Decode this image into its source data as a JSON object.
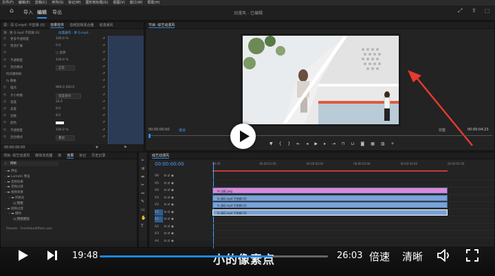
{
  "menubar": {
    "items": [
      "文件(F)",
      "编辑(E)",
      "剪辑(C)",
      "序列(S)",
      "标记(M)",
      "图形和标题(G)",
      "视图(V)",
      "窗口(W)",
      "帮助(H)"
    ]
  },
  "header": {
    "workspaces": [
      "导入",
      "编辑",
      "导出"
    ],
    "title": "动漫风 - 已编辑"
  },
  "effect_controls": {
    "tabs": [
      "源：清 Q.mp4: 不剪辑 (0)",
      "效果控件",
      "音频剪辑混合器",
      "动漫通风"
    ],
    "clip_label": "源 · 清 Q.mp4 不剪辑 (0)",
    "clip_value": "动漫通风 · 清 Q.mp4...",
    "rows": [
      {
        "label": "更多不透明度",
        "value": "100.0 %"
      },
      {
        "label": "更多扩展",
        "value": "0.0"
      },
      {
        "label": "",
        "value": "□ 反转",
        "plain": true
      },
      {
        "label": "不透明度",
        "value": "100.0 %"
      },
      {
        "label": "混合模式",
        "value": "正常",
        "dropdown": true
      },
      {
        "label": "时间重映射",
        "value": ""
      },
      {
        "label": "fx 网格",
        "value": ""
      },
      {
        "label": "锚点",
        "value": "960.0   540.0"
      },
      {
        "label": "大小依据",
        "value": "宽度滑块",
        "dropdown": true
      },
      {
        "label": "宽度",
        "value": "24.0"
      },
      {
        "label": "高度",
        "value": "8.0"
      },
      {
        "label": "边框",
        "value": "8.0"
      },
      {
        "label": "颜色",
        "value": ""
      },
      {
        "label": "不透明度",
        "value": "100.0 %"
      },
      {
        "label": "混合模式",
        "value": "叠加",
        "dropdown": true
      }
    ],
    "timecode": "00:00:00:00"
  },
  "program_monitor": {
    "tab": "节目: 综艺动漫风",
    "timecode": "00:00:00:00",
    "fit": "适合",
    "quality": "完整",
    "duration": "00:00:04:23"
  },
  "project_panel": {
    "tabs": [
      "项目: 综艺动漫风",
      "媒体浏览器",
      "库",
      "效果",
      "标记",
      "历史记录"
    ],
    "search": "网格",
    "items": [
      "预设",
      "Lumetri 预设",
      "音频效果",
      "音频过渡",
      "视频效果",
      "风格化",
      "网格",
      "视频过渡",
      "擦除",
      "网格擦除"
    ],
    "footer": "Presets · FreeVideoEffect.com"
  },
  "timeline": {
    "tab": "综艺动漫风",
    "timecode": "00:00:00:00",
    "ruler": [
      "00:00",
      "00:00:01:00",
      "00:00:02:00",
      "00:00:03:00",
      "00:00:04:00",
      "00:00:05:00"
    ],
    "tracks": [
      "V6",
      "V5",
      "V4",
      "V3",
      "V2",
      "V1",
      "A1",
      "A2",
      "A3",
      "A4"
    ],
    "clips": [
      {
        "label": "fx 边框.png",
        "color": "#d98ad9"
      },
      {
        "label": "fx 清Q.mp4 不剪辑 (0)",
        "color": "#7aa3d6"
      },
      {
        "label": "fx 清Q.mp4 不剪辑 (0)",
        "color": "#7aa3d6"
      },
      {
        "label": "fx 清Q.mp4 不剪辑 (0)",
        "color": "#7aa3d6"
      }
    ]
  },
  "player": {
    "current_time": "19:48",
    "total_time": "26:03",
    "speed_label": "倍速",
    "quality_label": "清晰",
    "subtitle": "小的像素点",
    "progress": 0.76
  },
  "colors": {
    "accent": "#2d8ceb",
    "arrow": "#e8392f",
    "player_progress": "#1e88e5"
  }
}
